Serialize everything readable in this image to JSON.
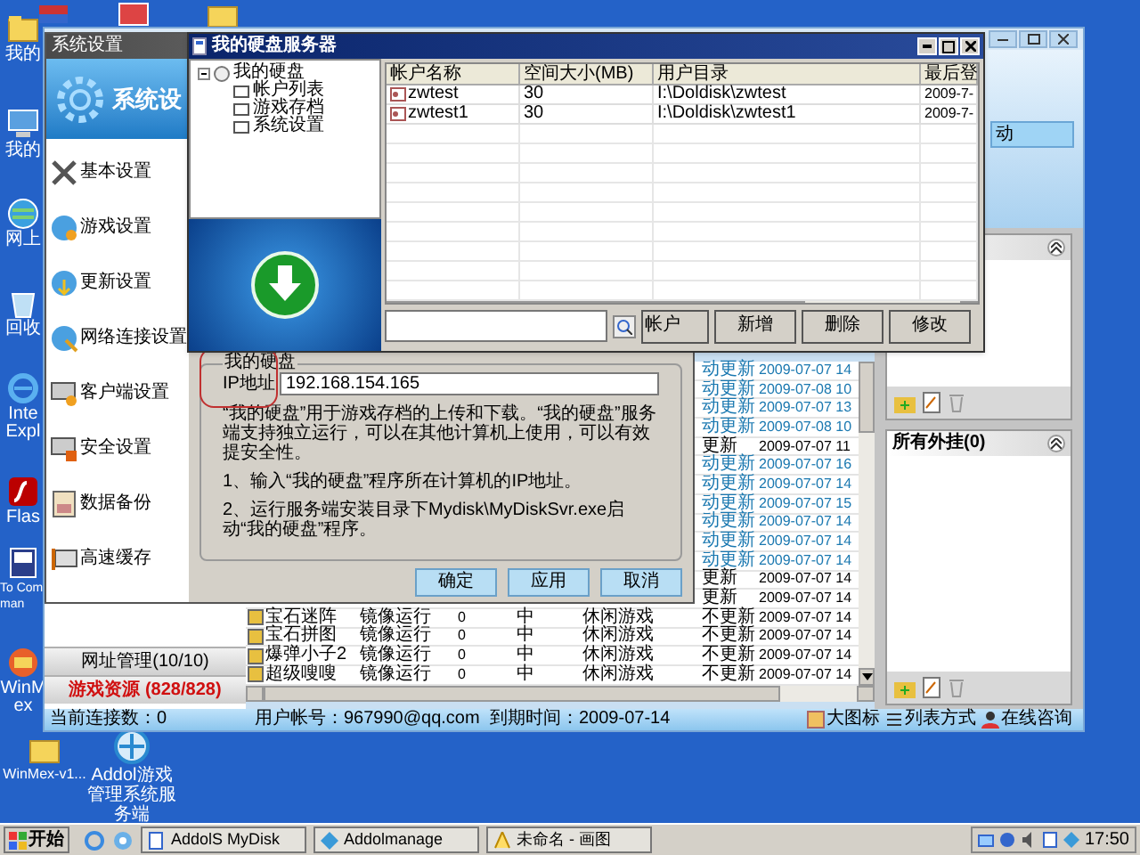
{
  "desktop": {
    "left_icons": [
      {
        "label": "我的"
      },
      {
        "label": "我的"
      },
      {
        "label": "网上"
      },
      {
        "label": "回收"
      },
      {
        "label": "Inte Expl"
      },
      {
        "label": "Flas"
      },
      {
        "label": "To Comman"
      },
      {
        "label": "WinMex"
      }
    ],
    "bottom_icons": [
      {
        "label": "WinMex-v1..."
      },
      {
        "label": "Addol游戏管理系统服务端"
      }
    ]
  },
  "manager_window": {
    "header_button": "动",
    "nav": [
      {
        "label": "网址管理(10/10)",
        "selected": false
      },
      {
        "label": "游戏资源 (828/828)",
        "selected": true
      }
    ],
    "games": {
      "rows": [
        {
          "update": "动更新",
          "date": "2009-07-07 14",
          "highlighted": true
        },
        {
          "update": "动更新",
          "date": "2009-07-08 10",
          "highlighted": true
        },
        {
          "update": "动更新",
          "date": "2009-07-07 13",
          "highlighted": true
        },
        {
          "update": "动更新",
          "date": "2009-07-08 10",
          "highlighted": true
        },
        {
          "update": "更新",
          "date": "2009-07-07 11",
          "highlighted": false
        },
        {
          "update": "动更新",
          "date": "2009-07-07 16",
          "highlighted": true
        },
        {
          "update": "动更新",
          "date": "2009-07-07 14",
          "highlighted": true
        },
        {
          "update": "动更新",
          "date": "2009-07-07 15",
          "highlighted": true
        },
        {
          "update": "动更新",
          "date": "2009-07-07 14",
          "highlighted": true
        },
        {
          "update": "动更新",
          "date": "2009-07-07 14",
          "highlighted": true
        },
        {
          "update": "动更新",
          "date": "2009-07-07 14",
          "highlighted": true
        },
        {
          "update": "更新",
          "date": "2009-07-07 14",
          "highlighted": false
        },
        {
          "update": "更新",
          "date": "2009-07-07 14",
          "highlighted": false
        },
        {
          "name": "宝石迷阵",
          "mode": "镜像运行",
          "count": "0",
          "level": "中",
          "category": "休闲游戏",
          "update": "不更新",
          "date": "2009-07-07 14",
          "highlighted": false
        },
        {
          "name": "宝石拼图",
          "mode": "镜像运行",
          "count": "0",
          "level": "中",
          "category": "休闲游戏",
          "update": "不更新",
          "date": "2009-07-07 14",
          "highlighted": false
        },
        {
          "name": "爆弹小子2",
          "mode": "镜像运行",
          "count": "0",
          "level": "中",
          "category": "休闲游戏",
          "update": "不更新",
          "date": "2009-07-07 14",
          "highlighted": false
        },
        {
          "name": "超级嗖嗖",
          "mode": "镜像运行",
          "count": "0",
          "level": "中",
          "category": "休闲游戏",
          "update": "不更新",
          "date": "2009-07-07 14",
          "highlighted": false
        }
      ]
    },
    "plugin_panel": {
      "title": "所有外挂(0)"
    },
    "status_bar": {
      "connections": "当前连接数：0",
      "account": "用户帐号：967990@qq.com",
      "expiry": "到期时间：2009-07-14",
      "actions": [
        "大图标",
        "列表方式",
        "在线咨询"
      ]
    }
  },
  "settings_window": {
    "title": "系统设置",
    "banner": "系统设",
    "items": [
      {
        "label": "基本设置"
      },
      {
        "label": "游戏设置"
      },
      {
        "label": "更新设置"
      },
      {
        "label": "网络连接设置"
      },
      {
        "label": "客户端设置"
      },
      {
        "label": "安全设置"
      },
      {
        "label": "数据备份"
      },
      {
        "label": "高速缓存"
      }
    ],
    "group": {
      "title": "我的硬盘",
      "ip_label": "IP地址",
      "ip_value": "192.168.154.165",
      "paragraphs": [
        "“我的硬盘”用于游戏存档的上传和下载。“我的硬盘”服务端支持独立运行，可以在其他计算机上使用，可以有效提安全性。",
        "1、输入“我的硬盘”程序所在计算机的IP地址。",
        "2、运行服务端安装目录下Mydisk\\MyDiskSvr.exe启动“我的硬盘”程序。"
      ]
    },
    "buttons": [
      "确定",
      "应用",
      "取消"
    ]
  },
  "disk_window": {
    "title": "我的硬盘服务器",
    "tree": {
      "label": "我的硬盘",
      "expanded": true,
      "children": [
        {
          "label": "帐户列表"
        },
        {
          "label": "游戏存档"
        },
        {
          "label": "系统设置"
        }
      ]
    },
    "table": {
      "columns": [
        "帐户名称",
        "空间大小(MB)",
        "用户目录",
        "最后登"
      ],
      "rows": [
        [
          "zwtest",
          "30",
          "I:\\Doldisk\\zwtest",
          "2009-7-"
        ],
        [
          "zwtest1",
          "30",
          "I:\\Doldisk\\zwtest1",
          "2009-7-"
        ]
      ]
    },
    "search_button": "帐户",
    "buttons": [
      "新增",
      "删除",
      "修改"
    ]
  },
  "taskbar": {
    "start": "开始",
    "tasks": [
      "AddolS MyDisk",
      "Addolmanage",
      "未命名 - 画图"
    ],
    "clock": "17:50"
  }
}
